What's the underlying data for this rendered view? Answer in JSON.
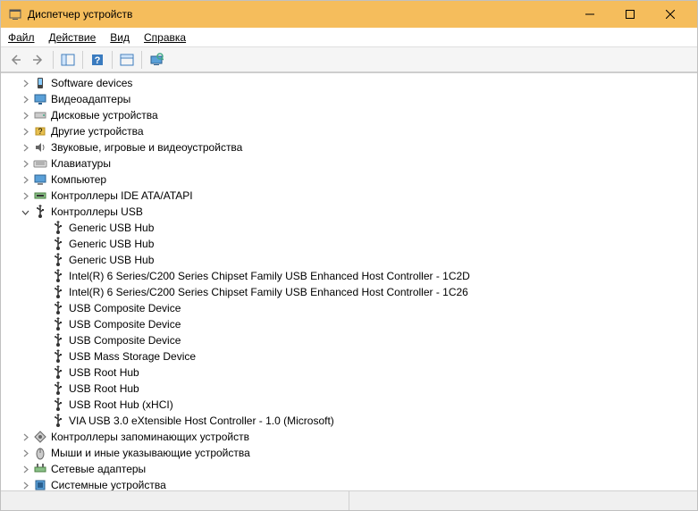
{
  "window": {
    "title": "Диспетчер устройств"
  },
  "menu": {
    "file": "Файл",
    "action": "Действие",
    "view": "Вид",
    "help": "Справка"
  },
  "tree": [
    {
      "level": 0,
      "expandable": true,
      "expanded": false,
      "icon": "software",
      "label": "Software devices"
    },
    {
      "level": 0,
      "expandable": true,
      "expanded": false,
      "icon": "display",
      "label": "Видеоадаптеры"
    },
    {
      "level": 0,
      "expandable": true,
      "expanded": false,
      "icon": "disk",
      "label": "Дисковые устройства"
    },
    {
      "level": 0,
      "expandable": true,
      "expanded": false,
      "icon": "other",
      "label": "Другие устройства"
    },
    {
      "level": 0,
      "expandable": true,
      "expanded": false,
      "icon": "audio",
      "label": "Звуковые, игровые и видеоустройства"
    },
    {
      "level": 0,
      "expandable": true,
      "expanded": false,
      "icon": "keyboard",
      "label": "Клавиатуры"
    },
    {
      "level": 0,
      "expandable": true,
      "expanded": false,
      "icon": "computer",
      "label": "Компьютер"
    },
    {
      "level": 0,
      "expandable": true,
      "expanded": false,
      "icon": "ide",
      "label": "Контроллеры IDE ATA/ATAPI"
    },
    {
      "level": 0,
      "expandable": true,
      "expanded": true,
      "icon": "usb",
      "label": "Контроллеры USB"
    },
    {
      "level": 1,
      "expandable": false,
      "icon": "usb",
      "label": "Generic USB Hub"
    },
    {
      "level": 1,
      "expandable": false,
      "icon": "usb",
      "label": "Generic USB Hub"
    },
    {
      "level": 1,
      "expandable": false,
      "icon": "usb",
      "label": "Generic USB Hub"
    },
    {
      "level": 1,
      "expandable": false,
      "icon": "usb",
      "label": "Intel(R) 6 Series/C200 Series Chipset Family USB Enhanced Host Controller - 1C2D"
    },
    {
      "level": 1,
      "expandable": false,
      "icon": "usb",
      "label": "Intel(R) 6 Series/C200 Series Chipset Family USB Enhanced Host Controller - 1C26"
    },
    {
      "level": 1,
      "expandable": false,
      "icon": "usb",
      "label": "USB Composite Device"
    },
    {
      "level": 1,
      "expandable": false,
      "icon": "usb",
      "label": "USB Composite Device"
    },
    {
      "level": 1,
      "expandable": false,
      "icon": "usb",
      "label": "USB Composite Device"
    },
    {
      "level": 1,
      "expandable": false,
      "icon": "usb",
      "label": "USB Mass Storage Device"
    },
    {
      "level": 1,
      "expandable": false,
      "icon": "usb",
      "label": "USB Root Hub"
    },
    {
      "level": 1,
      "expandable": false,
      "icon": "usb",
      "label": "USB Root Hub"
    },
    {
      "level": 1,
      "expandable": false,
      "icon": "usb",
      "label": "USB Root Hub (xHCI)"
    },
    {
      "level": 1,
      "expandable": false,
      "icon": "usb",
      "label": "VIA USB 3.0 eXtensible Host Controller - 1.0 (Microsoft)"
    },
    {
      "level": 0,
      "expandable": true,
      "expanded": false,
      "icon": "storage",
      "label": "Контроллеры запоминающих устройств"
    },
    {
      "level": 0,
      "expandable": true,
      "expanded": false,
      "icon": "mouse",
      "label": "Мыши и иные указывающие устройства"
    },
    {
      "level": 0,
      "expandable": true,
      "expanded": false,
      "icon": "network",
      "label": "Сетевые адаптеры"
    },
    {
      "level": 0,
      "expandable": true,
      "expanded": false,
      "icon": "system",
      "label": "Системные устройства"
    }
  ]
}
